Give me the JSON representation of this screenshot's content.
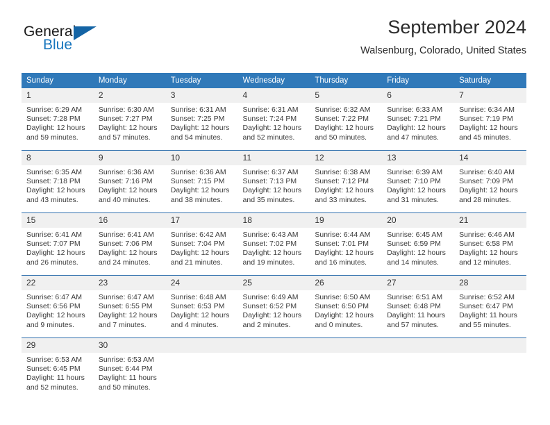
{
  "brand": {
    "name_part1": "General",
    "name_part2": "Blue",
    "logo_icon": "triangle-logo-icon"
  },
  "header": {
    "title": "September 2024",
    "subtitle": "Walsenburg, Colorado, United States"
  },
  "colors": {
    "header_blue": "#3079b9",
    "row_divider_blue": "#2f6fad",
    "daynum_background": "#f0f0f0",
    "brand_blue": "#1876bd",
    "logo_blue": "#1464a5"
  },
  "calendar": {
    "weekdays": [
      "Sunday",
      "Monday",
      "Tuesday",
      "Wednesday",
      "Thursday",
      "Friday",
      "Saturday"
    ],
    "weeks": [
      [
        {
          "day": "1",
          "sunrise": "Sunrise: 6:29 AM",
          "sunset": "Sunset: 7:28 PM",
          "daylight1": "Daylight: 12 hours",
          "daylight2": "and 59 minutes."
        },
        {
          "day": "2",
          "sunrise": "Sunrise: 6:30 AM",
          "sunset": "Sunset: 7:27 PM",
          "daylight1": "Daylight: 12 hours",
          "daylight2": "and 57 minutes."
        },
        {
          "day": "3",
          "sunrise": "Sunrise: 6:31 AM",
          "sunset": "Sunset: 7:25 PM",
          "daylight1": "Daylight: 12 hours",
          "daylight2": "and 54 minutes."
        },
        {
          "day": "4",
          "sunrise": "Sunrise: 6:31 AM",
          "sunset": "Sunset: 7:24 PM",
          "daylight1": "Daylight: 12 hours",
          "daylight2": "and 52 minutes."
        },
        {
          "day": "5",
          "sunrise": "Sunrise: 6:32 AM",
          "sunset": "Sunset: 7:22 PM",
          "daylight1": "Daylight: 12 hours",
          "daylight2": "and 50 minutes."
        },
        {
          "day": "6",
          "sunrise": "Sunrise: 6:33 AM",
          "sunset": "Sunset: 7:21 PM",
          "daylight1": "Daylight: 12 hours",
          "daylight2": "and 47 minutes."
        },
        {
          "day": "7",
          "sunrise": "Sunrise: 6:34 AM",
          "sunset": "Sunset: 7:19 PM",
          "daylight1": "Daylight: 12 hours",
          "daylight2": "and 45 minutes."
        }
      ],
      [
        {
          "day": "8",
          "sunrise": "Sunrise: 6:35 AM",
          "sunset": "Sunset: 7:18 PM",
          "daylight1": "Daylight: 12 hours",
          "daylight2": "and 43 minutes."
        },
        {
          "day": "9",
          "sunrise": "Sunrise: 6:36 AM",
          "sunset": "Sunset: 7:16 PM",
          "daylight1": "Daylight: 12 hours",
          "daylight2": "and 40 minutes."
        },
        {
          "day": "10",
          "sunrise": "Sunrise: 6:36 AM",
          "sunset": "Sunset: 7:15 PM",
          "daylight1": "Daylight: 12 hours",
          "daylight2": "and 38 minutes."
        },
        {
          "day": "11",
          "sunrise": "Sunrise: 6:37 AM",
          "sunset": "Sunset: 7:13 PM",
          "daylight1": "Daylight: 12 hours",
          "daylight2": "and 35 minutes."
        },
        {
          "day": "12",
          "sunrise": "Sunrise: 6:38 AM",
          "sunset": "Sunset: 7:12 PM",
          "daylight1": "Daylight: 12 hours",
          "daylight2": "and 33 minutes."
        },
        {
          "day": "13",
          "sunrise": "Sunrise: 6:39 AM",
          "sunset": "Sunset: 7:10 PM",
          "daylight1": "Daylight: 12 hours",
          "daylight2": "and 31 minutes."
        },
        {
          "day": "14",
          "sunrise": "Sunrise: 6:40 AM",
          "sunset": "Sunset: 7:09 PM",
          "daylight1": "Daylight: 12 hours",
          "daylight2": "and 28 minutes."
        }
      ],
      [
        {
          "day": "15",
          "sunrise": "Sunrise: 6:41 AM",
          "sunset": "Sunset: 7:07 PM",
          "daylight1": "Daylight: 12 hours",
          "daylight2": "and 26 minutes."
        },
        {
          "day": "16",
          "sunrise": "Sunrise: 6:41 AM",
          "sunset": "Sunset: 7:06 PM",
          "daylight1": "Daylight: 12 hours",
          "daylight2": "and 24 minutes."
        },
        {
          "day": "17",
          "sunrise": "Sunrise: 6:42 AM",
          "sunset": "Sunset: 7:04 PM",
          "daylight1": "Daylight: 12 hours",
          "daylight2": "and 21 minutes."
        },
        {
          "day": "18",
          "sunrise": "Sunrise: 6:43 AM",
          "sunset": "Sunset: 7:02 PM",
          "daylight1": "Daylight: 12 hours",
          "daylight2": "and 19 minutes."
        },
        {
          "day": "19",
          "sunrise": "Sunrise: 6:44 AM",
          "sunset": "Sunset: 7:01 PM",
          "daylight1": "Daylight: 12 hours",
          "daylight2": "and 16 minutes."
        },
        {
          "day": "20",
          "sunrise": "Sunrise: 6:45 AM",
          "sunset": "Sunset: 6:59 PM",
          "daylight1": "Daylight: 12 hours",
          "daylight2": "and 14 minutes."
        },
        {
          "day": "21",
          "sunrise": "Sunrise: 6:46 AM",
          "sunset": "Sunset: 6:58 PM",
          "daylight1": "Daylight: 12 hours",
          "daylight2": "and 12 minutes."
        }
      ],
      [
        {
          "day": "22",
          "sunrise": "Sunrise: 6:47 AM",
          "sunset": "Sunset: 6:56 PM",
          "daylight1": "Daylight: 12 hours",
          "daylight2": "and 9 minutes."
        },
        {
          "day": "23",
          "sunrise": "Sunrise: 6:47 AM",
          "sunset": "Sunset: 6:55 PM",
          "daylight1": "Daylight: 12 hours",
          "daylight2": "and 7 minutes."
        },
        {
          "day": "24",
          "sunrise": "Sunrise: 6:48 AM",
          "sunset": "Sunset: 6:53 PM",
          "daylight1": "Daylight: 12 hours",
          "daylight2": "and 4 minutes."
        },
        {
          "day": "25",
          "sunrise": "Sunrise: 6:49 AM",
          "sunset": "Sunset: 6:52 PM",
          "daylight1": "Daylight: 12 hours",
          "daylight2": "and 2 minutes."
        },
        {
          "day": "26",
          "sunrise": "Sunrise: 6:50 AM",
          "sunset": "Sunset: 6:50 PM",
          "daylight1": "Daylight: 12 hours",
          "daylight2": "and 0 minutes."
        },
        {
          "day": "27",
          "sunrise": "Sunrise: 6:51 AM",
          "sunset": "Sunset: 6:48 PM",
          "daylight1": "Daylight: 11 hours",
          "daylight2": "and 57 minutes."
        },
        {
          "day": "28",
          "sunrise": "Sunrise: 6:52 AM",
          "sunset": "Sunset: 6:47 PM",
          "daylight1": "Daylight: 11 hours",
          "daylight2": "and 55 minutes."
        }
      ],
      [
        {
          "day": "29",
          "sunrise": "Sunrise: 6:53 AM",
          "sunset": "Sunset: 6:45 PM",
          "daylight1": "Daylight: 11 hours",
          "daylight2": "and 52 minutes."
        },
        {
          "day": "30",
          "sunrise": "Sunrise: 6:53 AM",
          "sunset": "Sunset: 6:44 PM",
          "daylight1": "Daylight: 11 hours",
          "daylight2": "and 50 minutes."
        },
        {
          "day": "",
          "sunrise": "",
          "sunset": "",
          "daylight1": "",
          "daylight2": ""
        },
        {
          "day": "",
          "sunrise": "",
          "sunset": "",
          "daylight1": "",
          "daylight2": ""
        },
        {
          "day": "",
          "sunrise": "",
          "sunset": "",
          "daylight1": "",
          "daylight2": ""
        },
        {
          "day": "",
          "sunrise": "",
          "sunset": "",
          "daylight1": "",
          "daylight2": ""
        },
        {
          "day": "",
          "sunrise": "",
          "sunset": "",
          "daylight1": "",
          "daylight2": ""
        }
      ]
    ]
  }
}
